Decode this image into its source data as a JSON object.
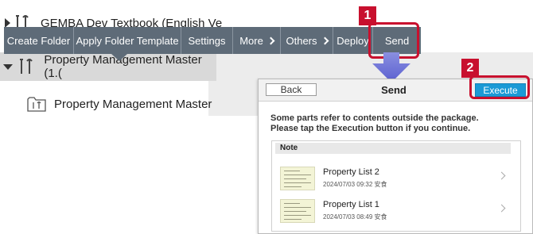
{
  "tree": {
    "row1_label": "GEMBA Dev Textbook (English Ve",
    "row2_label": "Property Management Master (1.(",
    "row3_label": "Property Management Master"
  },
  "toolbar": {
    "items": [
      {
        "label": "Create Folder"
      },
      {
        "label": "Apply Folder Template"
      },
      {
        "label": "Settings"
      },
      {
        "label": "More"
      },
      {
        "label": "Others"
      },
      {
        "label": "Deploy"
      },
      {
        "label": "Send"
      }
    ]
  },
  "callouts": {
    "step1": "1",
    "step2": "2"
  },
  "dialog": {
    "back_label": "Back",
    "title": "Send",
    "execute_label": "Execute",
    "message_line1": "Some parts refer to contents outside the package.",
    "message_line2": "Please tap the Execution button if you continue.",
    "note_header": "Note",
    "items": [
      {
        "name": "Property List 2",
        "date": "2024/07/03 09:32 安食"
      },
      {
        "name": "Property List 1",
        "date": "2024/07/03 08:49 安食"
      }
    ]
  },
  "colors": {
    "toolbar": "#5e6b78",
    "accent": "#1b9ad6",
    "callout": "#c8102e"
  }
}
